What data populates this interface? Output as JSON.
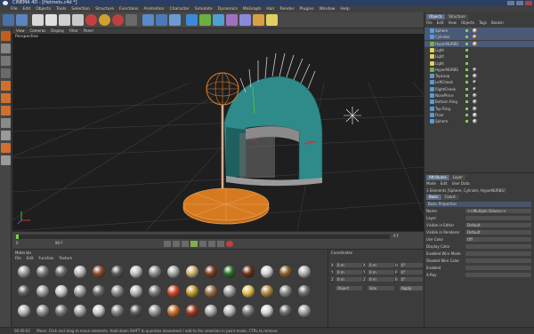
{
  "window": {
    "title": "CINEMA 4D - [Helmets.c4d *]"
  },
  "menu": [
    "File",
    "Edit",
    "Objects",
    "Tools",
    "Selection",
    "Structure",
    "Functions",
    "Animation",
    "Character",
    "Simulate",
    "Dynamics",
    "MoGraph",
    "Hair",
    "Render",
    "Plugins",
    "Window",
    "Help"
  ],
  "viewport": {
    "menu": [
      "View",
      "Cameras",
      "Display",
      "Filter",
      "Panel"
    ],
    "label": "Perspective",
    "colors": {
      "background": "#1e1e1e",
      "grid": "#3d3d3d",
      "helmet": "#2f8a8a",
      "base": "#c46f1a",
      "metal": "#9a9a9a"
    }
  },
  "timeline": {
    "frame_start": "0",
    "frame_end": "90 F",
    "current": "0 F"
  },
  "materials": {
    "menu": [
      "File",
      "Edit",
      "Function",
      "Texture"
    ],
    "title": "Materials",
    "swatch_colors": [
      "#9a9a9a",
      "#7c7c7c",
      "#6d6d6d",
      "#b6b6b6",
      "#8a4a2a",
      "#5a5a5a",
      "#c0c0c0",
      "#8f8f8f",
      "#a8a8a8",
      "#c8b070",
      "#7a3e20",
      "#2e6a2a",
      "#6a3018",
      "#d2d2d2",
      "#8a6030",
      "#b0b0b0",
      "#5e5e5e",
      "#9c9c9c",
      "#c4c4c4",
      "#a0a0a0",
      "#6a6a6a",
      "#8c8c8c",
      "#b8b8b8",
      "#7a7a7a",
      "#d04a2a",
      "#c49a30",
      "#9a7048",
      "#a0a0a0",
      "#e0c050",
      "#b08a40",
      "#8a8a8a",
      "#6e6e6e",
      "#b4b4b4",
      "#909090",
      "#787878",
      "#a4a4a4",
      "#cccccc",
      "#848484",
      "#5c5c5c",
      "#969696",
      "#c87030",
      "#9e3a20",
      "#aaaaaa",
      "#bcbcbc",
      "#7e7e7e",
      "#d8d8d8",
      "#6a6a6a",
      "#a2a2a2"
    ]
  },
  "coordinates": {
    "title": "Coordinates",
    "rows": [
      {
        "a": "X",
        "av": "0 m",
        "b": "X",
        "bv": "0 m",
        "c": "H",
        "cv": "0°"
      },
      {
        "a": "Y",
        "av": "0 m",
        "b": "Y",
        "bv": "0 m",
        "c": "P",
        "cv": "0°"
      },
      {
        "a": "Z",
        "av": "0 m",
        "b": "Z",
        "bv": "0 m",
        "c": "B",
        "cv": "0°"
      }
    ],
    "mode1": "Object",
    "mode2": "Size",
    "apply": "Apply"
  },
  "objects": {
    "tabs": [
      "Objects",
      "Structure"
    ],
    "menu": [
      "File",
      "Edit",
      "View",
      "Objects",
      "Tags",
      "Bookm"
    ],
    "items": [
      {
        "name": "Sphere",
        "icon": "#5b9bd5",
        "tag": "#c8a070"
      },
      {
        "name": "Cylinder",
        "icon": "#5b9bd5",
        "tag": "#b86a3a"
      },
      {
        "name": "HyperNURBS",
        "icon": "#7ab04a",
        "tag": "#c8a070"
      },
      {
        "name": "Light",
        "icon": "#e0d060",
        "tag": ""
      },
      {
        "name": "Light",
        "icon": "#e0d060",
        "tag": ""
      },
      {
        "name": "Light",
        "icon": "#e0d060",
        "tag": ""
      },
      {
        "name": "HyperNURBS",
        "icon": "#7ab04a",
        "tag": "#555"
      },
      {
        "name": "TopLoop",
        "icon": "#5b9bd5",
        "tag": "#888"
      },
      {
        "name": "LeftCheek",
        "icon": "#5b9bd5",
        "tag": "#3a3a3a"
      },
      {
        "name": "RightCheek",
        "icon": "#5b9bd5",
        "tag": "#3a3a3a"
      },
      {
        "name": "NosePiece",
        "icon": "#5b9bd5",
        "tag": "#777"
      },
      {
        "name": "Bottom Ring",
        "icon": "#5b9bd5",
        "tag": "#888"
      },
      {
        "name": "Top Ring",
        "icon": "#5b9bd5",
        "tag": "#888"
      },
      {
        "name": "Floor",
        "icon": "#5b9bd5",
        "tag": "#aaa"
      },
      {
        "name": "Sphere",
        "icon": "#5b9bd5",
        "tag": "#999"
      }
    ]
  },
  "attributes": {
    "tabs": [
      "Attributes",
      "Layer"
    ],
    "menu": [
      "Mode",
      "Edit",
      "User Data"
    ],
    "header": "3 Elements [Sphere, Cylinder, HyperNURBS]",
    "subtabs": [
      "Basic",
      "Coord."
    ],
    "section": "Basic Properties",
    "rows": [
      {
        "label": "Name",
        "value": "<<Multiple Values>>"
      },
      {
        "label": "Layer",
        "value": ""
      },
      {
        "label": "Visible in Editor",
        "value": "Default"
      },
      {
        "label": "Visible in Renderer",
        "value": "Default"
      },
      {
        "label": "Use Color",
        "value": "Off"
      },
      {
        "label": "Display Color",
        "value": ""
      },
      {
        "label": "Enabled Wire Mode",
        "value": ""
      },
      {
        "label": "Shaded Wire Color",
        "value": ""
      },
      {
        "label": "Enabled",
        "value": ""
      },
      {
        "label": "X-Ray",
        "value": ""
      }
    ]
  },
  "status": {
    "time": "00:00:02",
    "text": "Move: Click and drag to move elements. Hold down SHIFT to quantize movement / add to the selection in point mode, CTRL to remove."
  }
}
